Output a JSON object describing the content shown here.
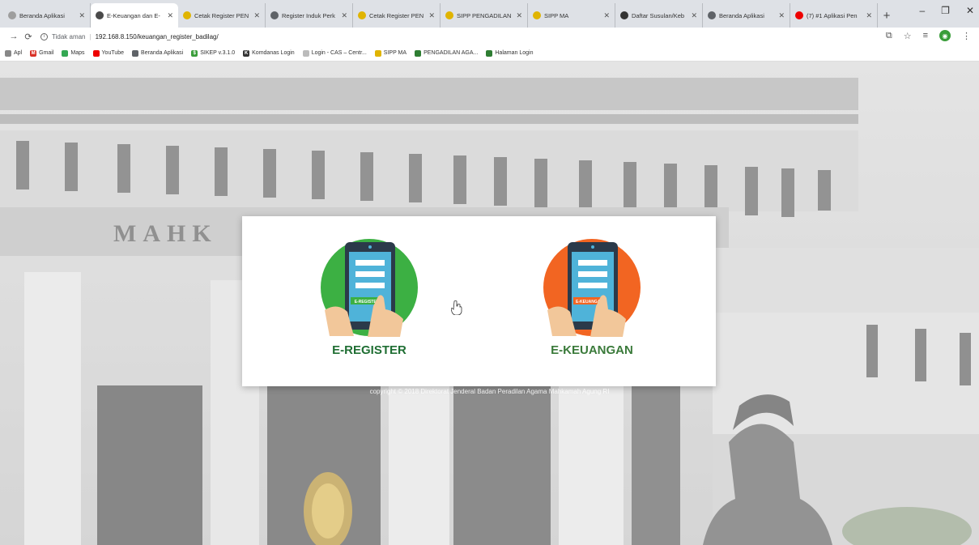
{
  "browser": {
    "tabs": [
      {
        "label": "Beranda Aplikasi",
        "fav": "#9e9e9e"
      },
      {
        "label": "E-Keuangan dan E-",
        "fav": "#4a4a4a",
        "active": true
      },
      {
        "label": "Cetak Register PEN",
        "fav": "#e0b400"
      },
      {
        "label": "Register Induk Perk",
        "fav": "#5f6368"
      },
      {
        "label": "Cetak Register PEN",
        "fav": "#e0b400"
      },
      {
        "label": "SIPP PENGADILAN A",
        "fav": "#e0b400"
      },
      {
        "label": "SIPP MA",
        "fav": "#e0b400"
      },
      {
        "label": "Daftar Susulan/Keb",
        "fav": "#333"
      },
      {
        "label": "Beranda Aplikasi",
        "fav": "#5f6368"
      },
      {
        "label": "(7) #1 Aplikasi Pen",
        "fav": "#e00"
      }
    ],
    "address": {
      "not_secure": "Tidak aman",
      "url": "192.168.8.150/keuangan_register_badilag/"
    },
    "bookmarks": [
      {
        "label": "Apl",
        "color": "#888"
      },
      {
        "label": "Gmail",
        "color": "#d93025",
        "glyph": "M"
      },
      {
        "label": "Maps",
        "color": "#34a853"
      },
      {
        "label": "YouTube",
        "color": "#e00"
      },
      {
        "label": "Beranda Aplikasi",
        "color": "#5f6368"
      },
      {
        "label": "SIKEP v.3.1.0",
        "color": "#3a9d3a",
        "glyph": "$"
      },
      {
        "label": "Komdanas Login",
        "color": "#333",
        "glyph": "K"
      },
      {
        "label": "Login - CAS – Centr...",
        "color": "#bbb"
      },
      {
        "label": "SIPP MA",
        "color": "#e0b400"
      },
      {
        "label": "PENGADILAN AGA...",
        "color": "#2e7d32"
      },
      {
        "label": "Halaman Login",
        "color": "#2e7d32"
      }
    ]
  },
  "card": {
    "apps": [
      {
        "label": "E-REGISTER",
        "screen_label": "E-REGISTER",
        "circle_color": "#3cb043"
      },
      {
        "label": "E-KEUANGAN",
        "screen_label": "E-KEUANGAN",
        "circle_color": "#f26522"
      }
    ]
  },
  "background": {
    "building_letters": "MAHK"
  },
  "footer": {
    "copyright": "copyright © 2018 Direktorat Jenderal Badan Peradilan Agama Mahkamah Agung RI"
  }
}
